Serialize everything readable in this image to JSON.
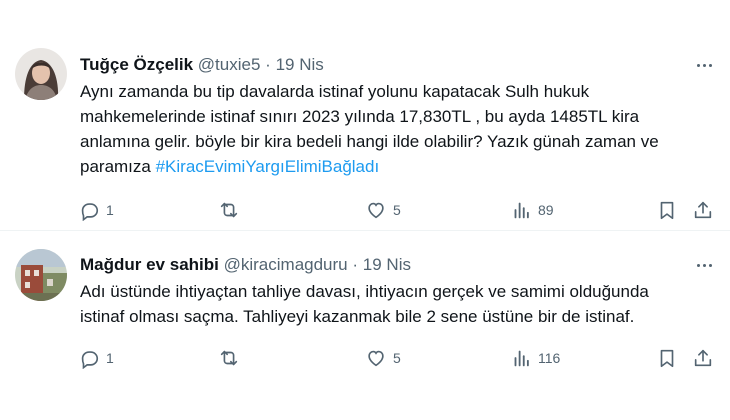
{
  "tweets": [
    {
      "name": "Tuğçe Özçelik",
      "handle": "@tuxie5",
      "sep": "·",
      "date": "19 Nis",
      "lines": [
        "Aynı zamanda bu tip davalarda istinaf yolunu kapatacak Sulh hukuk",
        "mahkemelerinde istinaf sınırı 2023 yılında 17,830TL , bu ayda 1485TL kira",
        "anlamına gelir. böyle bir kira bedeli hangi ilde olabilir? Yazık günah zaman ve",
        "paramıza "
      ],
      "hashtag": "#KiracEvimiYargıElimiBağladı",
      "replies": "1",
      "retweets": "",
      "likes": "5",
      "views": "89"
    },
    {
      "name": "Mağdur ev sahibi",
      "handle": "@kiracimagduru",
      "sep": "·",
      "date": "19 Nis",
      "lines": [
        "Adı üstünde ihtiyaçtan tahliye davası, ihtiyacın gerçek ve samimi olduğunda",
        "istinaf olması saçma. Tahliyeyi kazanmak bile 2 sene üstüne bir de istinaf."
      ],
      "replies": "1",
      "retweets": "",
      "likes": "5",
      "views": "116"
    }
  ],
  "icons": {
    "reply": "reply-icon",
    "retweet": "retweet-icon",
    "like": "heart-icon",
    "views": "views-chart-icon",
    "bookmark": "bookmark-icon",
    "share": "share-icon",
    "more": "more-dots-icon"
  },
  "colors": {
    "text": "#0f1419",
    "muted": "#536471",
    "link": "#1d9bf0",
    "divider": "#eff3f4"
  }
}
